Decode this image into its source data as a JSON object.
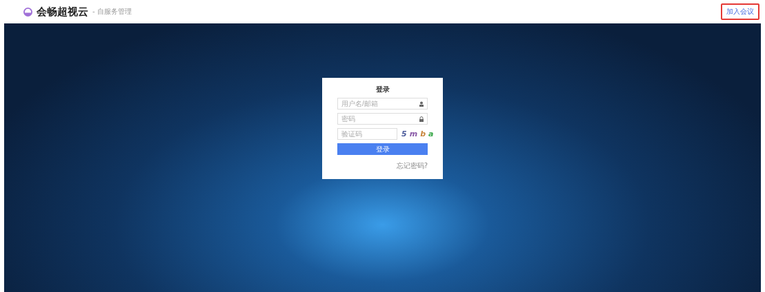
{
  "header": {
    "brand": "会畅超视云",
    "subtitle": "- 自服务管理",
    "join_link": "加入会议"
  },
  "login": {
    "title": "登录",
    "username": {
      "placeholder": "用户名/邮箱"
    },
    "password": {
      "placeholder": "密码"
    },
    "captcha": {
      "placeholder": "验证码",
      "chars": [
        {
          "text": "5",
          "color": "#4a5a9a"
        },
        {
          "text": "m",
          "color": "#8a5aa8"
        },
        {
          "text": "b",
          "color": "#c8843a"
        },
        {
          "text": "a",
          "color": "#3aa84a"
        }
      ]
    },
    "submit": "登录",
    "forgot": "忘记密码?"
  }
}
